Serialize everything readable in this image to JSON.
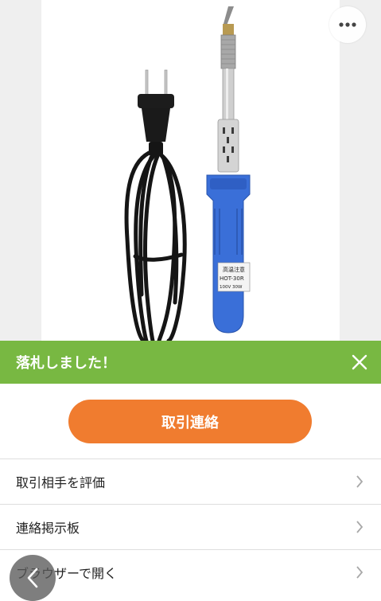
{
  "colors": {
    "banner_bg": "#78b842",
    "cta_bg": "#f07c2f",
    "iron_handle": "#3a6fd8"
  },
  "product": {
    "image": "soldering-iron-photo",
    "label_lines": [
      "高温注意",
      "HOT-30R",
      "100V 30W"
    ]
  },
  "top_actions": {
    "more_icon": "ellipsis-icon"
  },
  "banner": {
    "text": "落札しました！",
    "close_icon": "close-icon"
  },
  "cta": {
    "label": "取引連絡"
  },
  "menu": {
    "items": [
      {
        "label": "取引相手を評価",
        "icon": "chevron-right-icon"
      },
      {
        "label": "連絡掲示板",
        "icon": "chevron-right-icon"
      },
      {
        "label": "ブラウザーで開く",
        "icon": "chevron-right-icon"
      }
    ]
  },
  "nav": {
    "back_icon": "chevron-left-icon"
  }
}
